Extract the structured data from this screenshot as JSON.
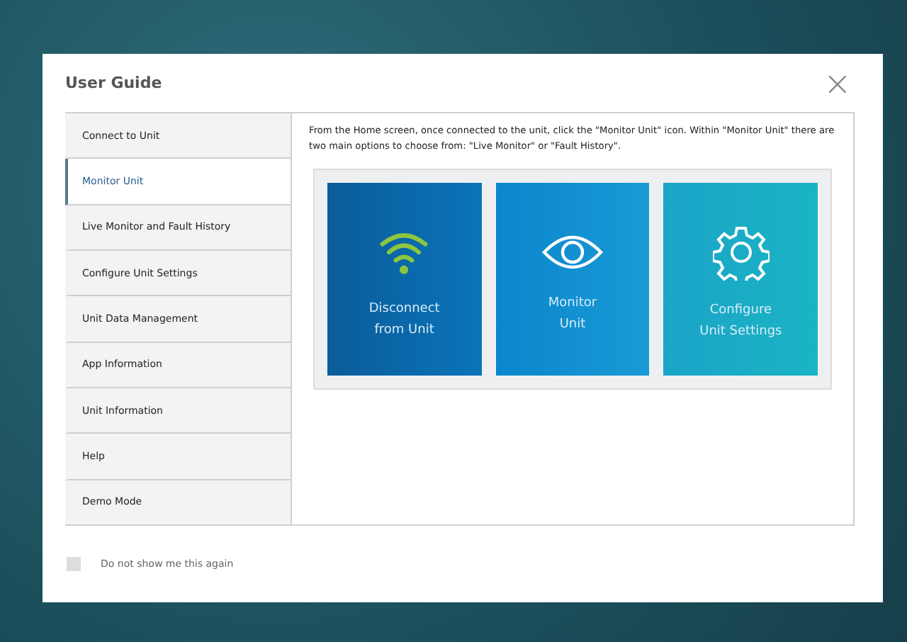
{
  "dialog": {
    "title": "User Guide",
    "close": "×"
  },
  "sidebar": {
    "items": [
      {
        "label": "Connect to Unit",
        "selected": false
      },
      {
        "label": "Monitor Unit",
        "selected": true
      },
      {
        "label": "Live Monitor and Fault History",
        "selected": false
      },
      {
        "label": "Configure Unit Settings",
        "selected": false
      },
      {
        "label": "Unit Data Management",
        "selected": false
      },
      {
        "label": "App Information",
        "selected": false
      },
      {
        "label": "Unit Information",
        "selected": false
      },
      {
        "label": "Help",
        "selected": false
      },
      {
        "label": "Demo Mode",
        "selected": false
      }
    ]
  },
  "content": {
    "text": "From the Home screen, once connected to the unit, click the \"Monitor Unit\" icon. Within \"Monitor Unit\" there are two main options to choose from: \"Live Monitor\" or \"Fault History\".",
    "tiles": [
      {
        "kind": "wifi",
        "lines": [
          "Disconnect",
          "from Unit"
        ]
      },
      {
        "kind": "eye",
        "lines": [
          "Monitor",
          "Unit"
        ]
      },
      {
        "kind": "gear",
        "lines": [
          "Configure",
          "Unit Settings"
        ]
      }
    ]
  },
  "footer": {
    "checkbox": {
      "label": "Do not show me this again",
      "checked": false
    }
  }
}
